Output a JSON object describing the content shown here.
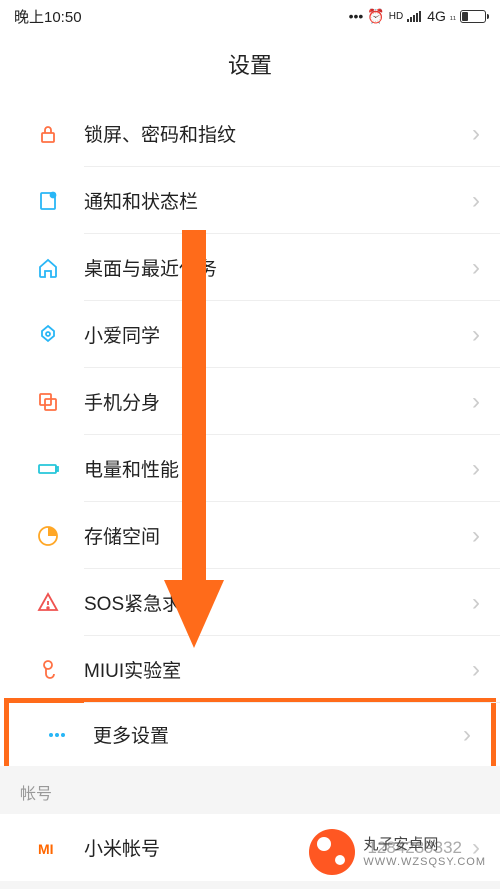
{
  "status": {
    "time": "晚上10:50",
    "network": "4G",
    "hd": "HD"
  },
  "header": {
    "title": "设置"
  },
  "items": {
    "lock": "锁屏、密码和指纹",
    "notification": "通知和状态栏",
    "desktop": "桌面与最近任务",
    "xiaoai": "小爱同学",
    "clone": "手机分身",
    "battery": "电量和性能",
    "storage": "存储空间",
    "sos": "SOS紧急求助",
    "lab": "MIUI实验室",
    "more": "更多设置"
  },
  "section": {
    "account": "帐号"
  },
  "account": {
    "xiaomi_label": "小米帐号",
    "xiaomi_value": "1284239332"
  },
  "watermark": {
    "name": "丸子安卓网",
    "url": "WWW.WZSQSY.COM"
  }
}
